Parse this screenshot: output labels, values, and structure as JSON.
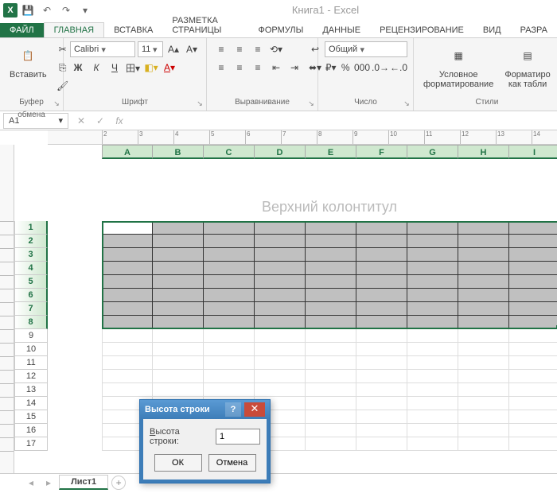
{
  "title": "Книга1 - Excel",
  "qat": {
    "save": "💾",
    "undo": "↶",
    "redo": "↷"
  },
  "tabs": {
    "file": "ФАЙЛ",
    "items": [
      "ГЛАВНАЯ",
      "ВСТАВКА",
      "РАЗМЕТКА СТРАНИЦЫ",
      "ФОРМУЛЫ",
      "ДАННЫЕ",
      "РЕЦЕНЗИРОВАНИЕ",
      "ВИД",
      "РАЗРА"
    ]
  },
  "ribbon": {
    "clipboard": {
      "paste": "Вставить",
      "label": "Буфер обмена"
    },
    "font": {
      "name": "Calibri",
      "size": "11",
      "bold": "Ж",
      "italic": "К",
      "underline": "Ч",
      "label": "Шрифт"
    },
    "align": {
      "label": "Выравнивание"
    },
    "number": {
      "format": "Общий",
      "label": "Число"
    },
    "styles": {
      "cond": "Условное форматирование",
      "table": "Форматиро как табли",
      "label": "Стили"
    }
  },
  "namebox": "A1",
  "header_placeholder": "Верхний колонтитул",
  "columns": [
    "A",
    "B",
    "C",
    "D",
    "E",
    "F",
    "G",
    "H",
    "I"
  ],
  "rows_selected": [
    1,
    2,
    3,
    4,
    5,
    6,
    7,
    8
  ],
  "rows_plain": [
    9,
    10,
    11,
    12,
    13,
    14,
    15,
    16,
    17
  ],
  "sheet_tab": "Лист1",
  "dialog": {
    "title": "Высота строки",
    "field_label_pre": "В",
    "field_label_rest": "ысота строки:",
    "value": "1",
    "ok": "ОК",
    "cancel": "Отмена"
  }
}
